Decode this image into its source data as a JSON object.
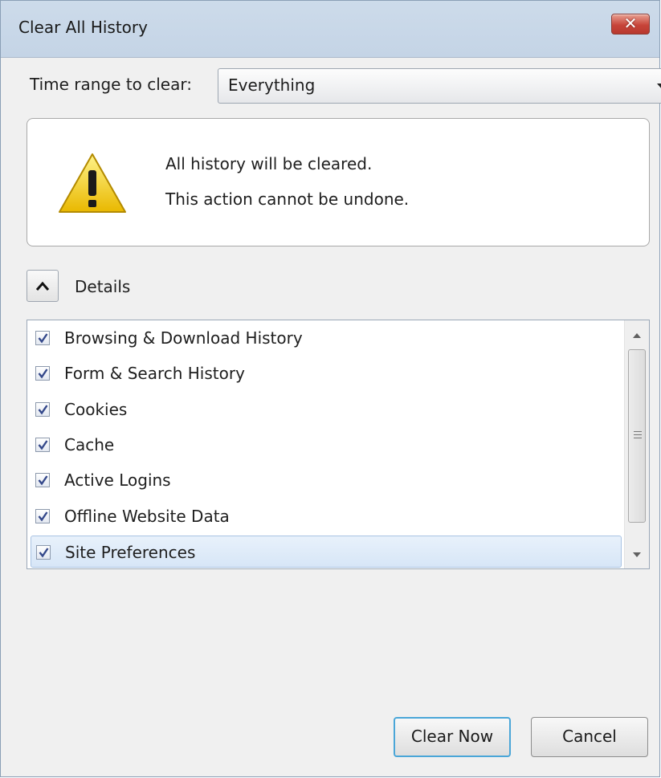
{
  "window": {
    "title": "Clear All History",
    "close_glyph": "✕"
  },
  "time_range": {
    "label": "Time range to clear:",
    "selected": "Everything"
  },
  "warning": {
    "icon": "warning-icon",
    "line1": "All history will be cleared.",
    "line2": "This action cannot be undone."
  },
  "details": {
    "label": "Details",
    "expanded": true
  },
  "items": [
    {
      "label": "Browsing & Download History",
      "checked": true
    },
    {
      "label": "Form & Search History",
      "checked": true
    },
    {
      "label": "Cookies",
      "checked": true
    },
    {
      "label": "Cache",
      "checked": true
    },
    {
      "label": "Active Logins",
      "checked": true
    },
    {
      "label": "Offline Website Data",
      "checked": true
    },
    {
      "label": "Site Preferences",
      "checked": true,
      "selected": true
    }
  ],
  "buttons": {
    "clear_now": "Clear Now",
    "cancel": "Cancel"
  },
  "colors": {
    "titlebar": "#c8d7e8",
    "close": "#c7453a",
    "selection": "#d7e6f7",
    "default_button_border": "#4aa6d8"
  }
}
